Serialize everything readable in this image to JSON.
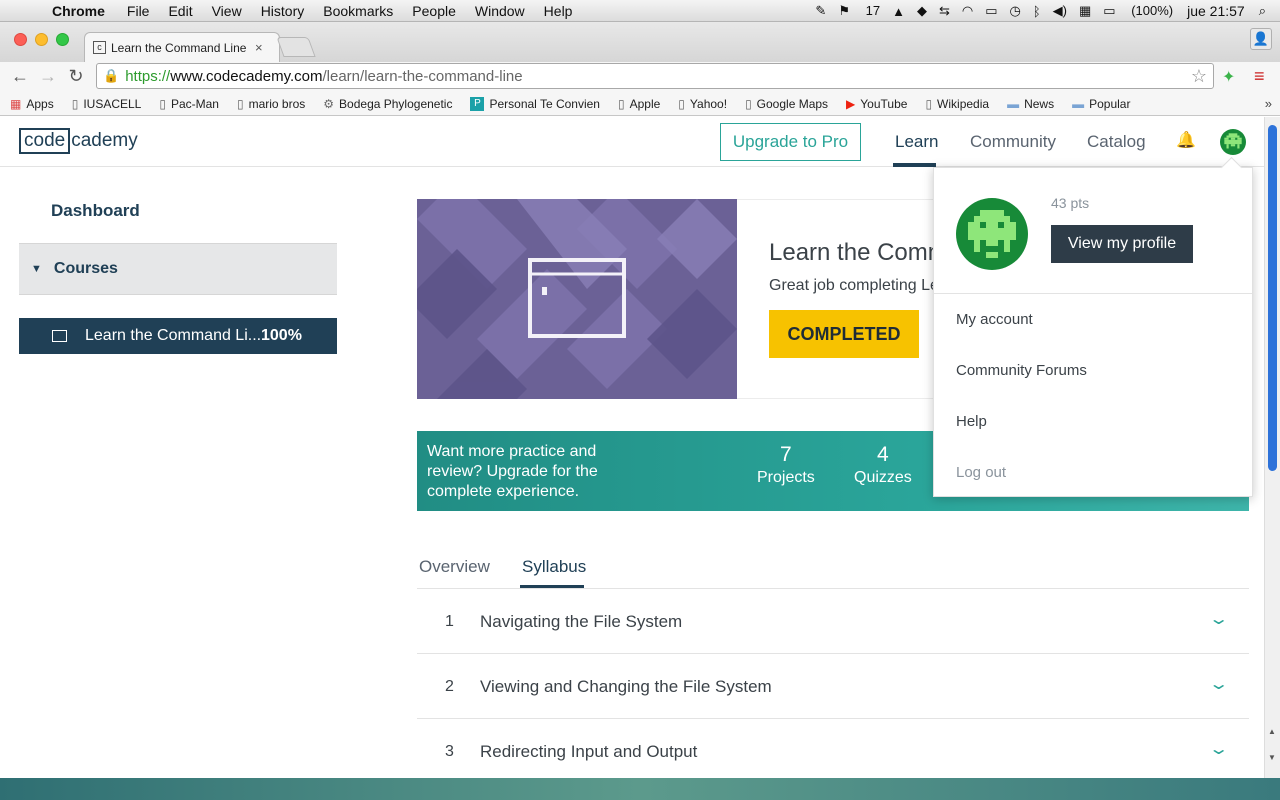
{
  "menubar": {
    "app_name": "Chrome",
    "items": [
      "File",
      "Edit",
      "View",
      "History",
      "Bookmarks",
      "People",
      "Window",
      "Help"
    ],
    "status": {
      "notifications_count": "17",
      "battery": "(100%)",
      "clock": "jue 21:57"
    }
  },
  "browser": {
    "tab_title": "Learn the Command Line | Codecademy",
    "favicon_letter": "c",
    "url": {
      "scheme": "https://",
      "host": "www.codecademy.com",
      "path": "/learn/learn-the-command-line"
    },
    "bookmarks": [
      {
        "label": "Apps",
        "icon": "apps-grid-icon"
      },
      {
        "label": "IUSACELL",
        "icon": "page-icon"
      },
      {
        "label": "Pac-Man",
        "icon": "page-icon"
      },
      {
        "label": "mario bros",
        "icon": "page-icon"
      },
      {
        "label": "Bodega Phylogenetic",
        "icon": "gear-icon"
      },
      {
        "label": "Personal Te Convien",
        "icon": "p-icon"
      },
      {
        "label": "Apple",
        "icon": "page-icon"
      },
      {
        "label": "Yahoo!",
        "icon": "page-icon"
      },
      {
        "label": "Google Maps",
        "icon": "page-icon"
      },
      {
        "label": "YouTube",
        "icon": "youtube-icon"
      },
      {
        "label": "Wikipedia",
        "icon": "page-icon"
      },
      {
        "label": "News",
        "icon": "folder-icon"
      },
      {
        "label": "Popular",
        "icon": "folder-icon"
      }
    ]
  },
  "site": {
    "logo_left": "code",
    "logo_right": "cademy",
    "upgrade_label": "Upgrade to Pro",
    "nav": {
      "learn": "Learn",
      "community": "Community",
      "catalog": "Catalog"
    }
  },
  "sidebar": {
    "dashboard": "Dashboard",
    "courses": "Courses",
    "course_name": "Learn the Command Li...",
    "course_progress": "100%"
  },
  "course": {
    "title": "Learn the Command Line",
    "subtitle": "Great job completing Learn the Command Line!",
    "status_label": "COMPLETED"
  },
  "banner": {
    "text": "Want more practice and review? Upgrade for the complete experience.",
    "stats": [
      {
        "num": "7",
        "label": "Projects"
      },
      {
        "num": "4",
        "label": "Quizzes"
      }
    ]
  },
  "tabs": {
    "overview": "Overview",
    "syllabus": "Syllabus"
  },
  "syllabus": [
    {
      "num": "1",
      "title": "Navigating the File System"
    },
    {
      "num": "2",
      "title": "Viewing and Changing the File System"
    },
    {
      "num": "3",
      "title": "Redirecting Input and Output"
    }
  ],
  "dropdown": {
    "points": "43 pts",
    "view_profile": "View my profile",
    "items": {
      "my_account": "My account",
      "community_forums": "Community Forums",
      "help": "Help",
      "log_out": "Log out"
    }
  },
  "colors": {
    "brand_navy": "#204056",
    "teal": "#2aa498",
    "completed_yellow": "#f7c200",
    "hero_purple": "#6d6397"
  }
}
